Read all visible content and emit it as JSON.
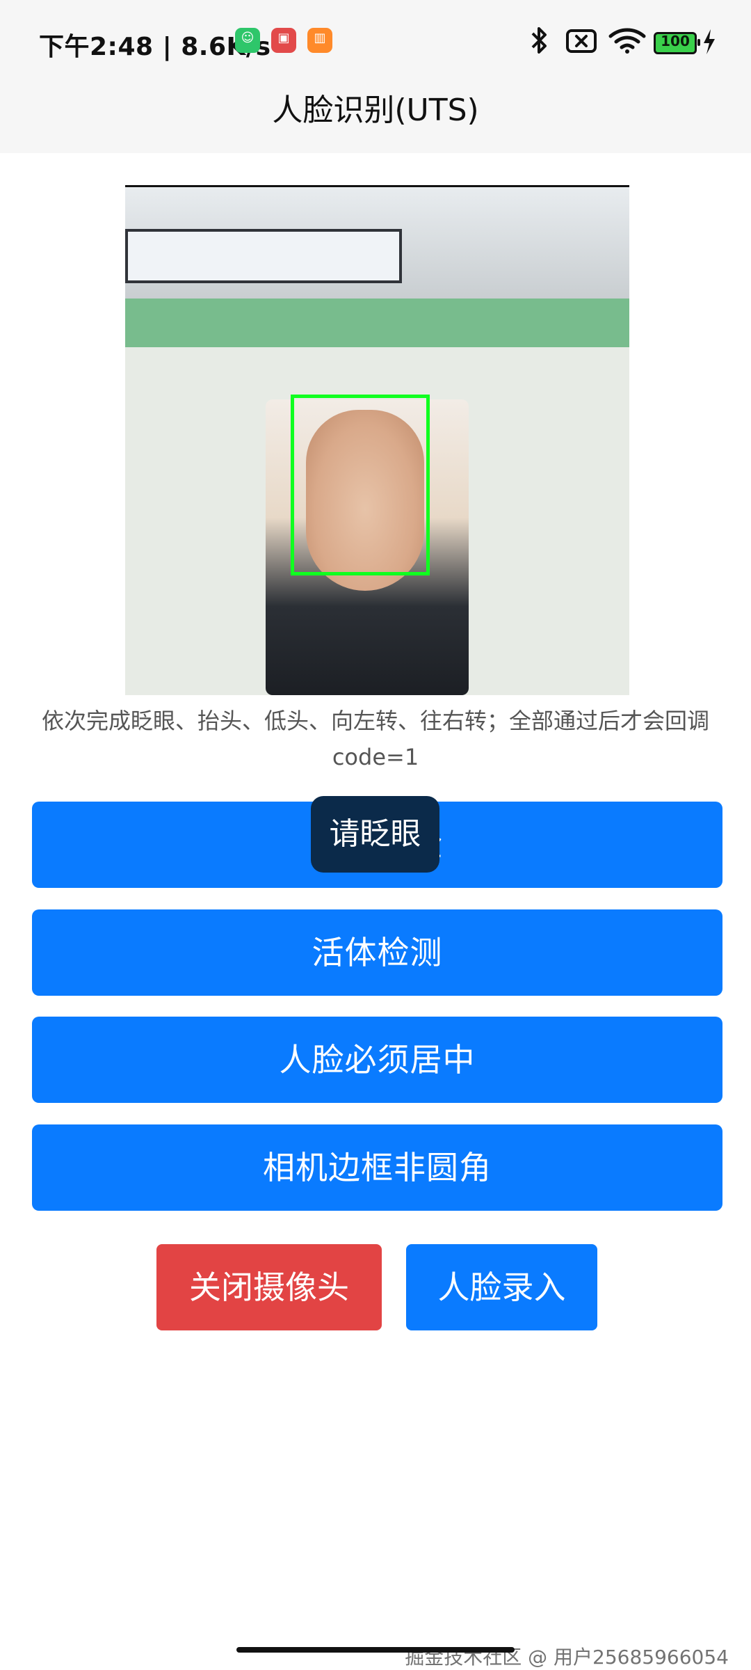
{
  "status_bar": {
    "time_speed": "下午2:48 | 8.6K/s",
    "battery": "100",
    "app_icons": [
      "green-app-icon",
      "red-app-icon",
      "orange-app-icon"
    ],
    "system_icons": [
      "bluetooth-icon",
      "sim-x-icon",
      "wifi-icon",
      "battery-icon",
      "charging-bolt-icon"
    ]
  },
  "nav": {
    "title": "人脸识别(UTS)"
  },
  "hint": {
    "text": "依次完成眨眼、抬头、低头、向左转、往右转；全部通过后才会回调 code=1"
  },
  "buttons": {
    "btn1": "必须正脸",
    "btn2": "活体检测",
    "btn3": "人脸必须居中",
    "btn4": "相机边框非圆角",
    "close_camera": "关闭摄像头",
    "face_enroll": "人脸录入"
  },
  "toast": {
    "text": "请眨眼"
  },
  "watermark": {
    "text": "掘金技术社区 @ 用户25685966054"
  },
  "colors": {
    "primary_blue": "#0a7bff",
    "danger_red": "#e24444",
    "face_box_green": "#10ff20"
  }
}
